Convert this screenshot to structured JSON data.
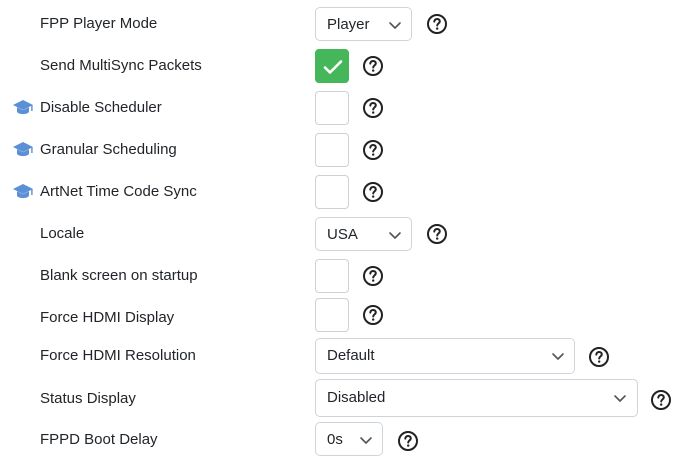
{
  "settings": {
    "fpp_player_mode": {
      "label": "FPP Player Mode",
      "value": "Player"
    },
    "send_multisync": {
      "label": "Send MultiSync Packets",
      "checked": true
    },
    "disable_scheduler": {
      "label": "Disable Scheduler",
      "checked": false
    },
    "granular_scheduling": {
      "label": "Granular Scheduling",
      "checked": false
    },
    "artnet_timecode": {
      "label": "ArtNet Time Code Sync",
      "checked": false
    },
    "locale": {
      "label": "Locale",
      "value": "USA"
    },
    "blank_screen": {
      "label": "Blank screen on startup",
      "checked": false
    },
    "force_hdmi_display": {
      "label": "Force HDMI Display",
      "checked": false
    },
    "force_hdmi_resolution": {
      "label": "Force HDMI Resolution",
      "value": "Default"
    },
    "status_display": {
      "label": "Status Display",
      "value": "Disabled"
    },
    "boot_delay": {
      "label": "FPPD Boot Delay",
      "value": "0s"
    }
  },
  "icons": {
    "advanced": "graduation-cap-icon",
    "help": "question-circle-icon",
    "dropdown": "chevron-down-icon",
    "check": "checkmark-icon"
  },
  "colors": {
    "check_on": "#45b75a",
    "advanced_icon": "#5b8fd6"
  }
}
